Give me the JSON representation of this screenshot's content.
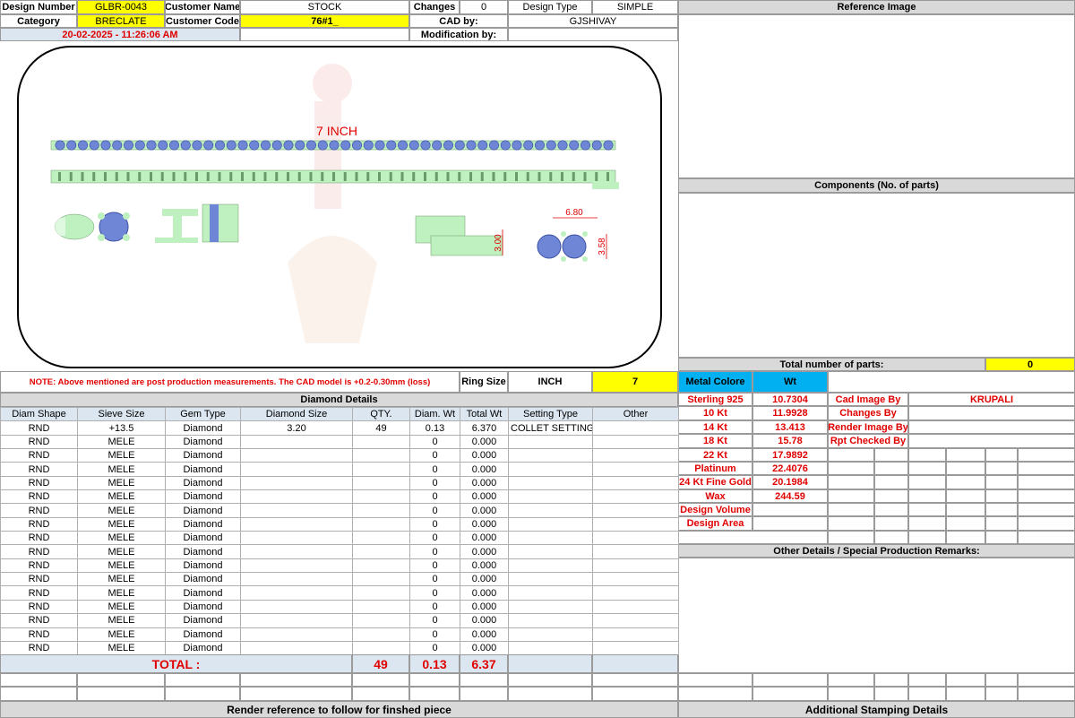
{
  "header": {
    "design_number_label": "Design Number",
    "design_number": "GLBR-0043",
    "customer_name_label": "Customer Name",
    "customer_name": "STOCK",
    "changes_label": "Changes",
    "changes": "0",
    "design_type_label": "Design Type",
    "design_type": "SIMPLE",
    "category_label": "Category",
    "category": "BRECLATE",
    "customer_code_label": "Customer Code",
    "customer_code": "76#1_",
    "cad_by_label": "CAD by:",
    "cad_by": "GJSHIVAY",
    "datetime": "20-02-2025 - 11:26:06 AM",
    "modification_by_label": "Modification by:"
  },
  "drawing": {
    "length_label": "7 INCH",
    "dim_width": "6.80",
    "dim_height1": "3.00",
    "dim_height2": "3.58"
  },
  "right_panel": {
    "reference_image_label": "Reference Image",
    "components_label": "Components (No. of parts)",
    "total_parts_label": "Total number of parts:",
    "total_parts": "0",
    "metal_colore_label": "Metal Colore",
    "wt_label": "Wt",
    "metals": [
      {
        "name": "Sterling 925",
        "wt": "10.7304"
      },
      {
        "name": "10 Kt",
        "wt": "11.9928"
      },
      {
        "name": "14 Kt",
        "wt": "13.413"
      },
      {
        "name": "18 Kt",
        "wt": "15.78"
      },
      {
        "name": "22 Kt",
        "wt": "17.9892"
      },
      {
        "name": "Platinum",
        "wt": "22.4076"
      },
      {
        "name": "24 Kt Fine Gold",
        "wt": "20.1984"
      },
      {
        "name": "Wax",
        "wt": "244.59"
      },
      {
        "name": "Design Volume",
        "wt": ""
      },
      {
        "name": "Design Area",
        "wt": ""
      }
    ],
    "cad_image_by_label": "Cad Image By",
    "cad_image_by": "KRUPALI",
    "changes_by_label": "Changes By",
    "render_image_by_label": "Render Image By",
    "rpt_checked_by_label": "Rpt Checked By",
    "other_details_label": "Other Details / Special Production Remarks:",
    "stamping_label": "Additional Stamping Details"
  },
  "note": {
    "text": "NOTE: Above mentioned are post production measurements. The CAD model is +0.2-0.30mm (loss)",
    "ring_size_label": "Ring Size",
    "ring_size_unit": "INCH",
    "ring_size_value": "7"
  },
  "diamond": {
    "title": "Diamond Details",
    "headers": [
      "Diam Shape",
      "Sieve Size",
      "Gem Type",
      "Diamond Size",
      "QTY.",
      "Diam. Wt",
      "Total Wt",
      "Setting Type",
      "Other"
    ],
    "rows": [
      [
        "RND",
        "+13.5",
        "Diamond",
        "3.20",
        "49",
        "0.13",
        "6.370",
        "COLLET SETTING",
        ""
      ],
      [
        "RND",
        "MELE",
        "Diamond",
        "",
        "",
        "0",
        "0.000",
        "",
        ""
      ],
      [
        "RND",
        "MELE",
        "Diamond",
        "",
        "",
        "0",
        "0.000",
        "",
        ""
      ],
      [
        "RND",
        "MELE",
        "Diamond",
        "",
        "",
        "0",
        "0.000",
        "",
        ""
      ],
      [
        "RND",
        "MELE",
        "Diamond",
        "",
        "",
        "0",
        "0.000",
        "",
        ""
      ],
      [
        "RND",
        "MELE",
        "Diamond",
        "",
        "",
        "0",
        "0.000",
        "",
        ""
      ],
      [
        "RND",
        "MELE",
        "Diamond",
        "",
        "",
        "0",
        "0.000",
        "",
        ""
      ],
      [
        "RND",
        "MELE",
        "Diamond",
        "",
        "",
        "0",
        "0.000",
        "",
        ""
      ],
      [
        "RND",
        "MELE",
        "Diamond",
        "",
        "",
        "0",
        "0.000",
        "",
        ""
      ],
      [
        "RND",
        "MELE",
        "Diamond",
        "",
        "",
        "0",
        "0.000",
        "",
        ""
      ],
      [
        "RND",
        "MELE",
        "Diamond",
        "",
        "",
        "0",
        "0.000",
        "",
        ""
      ],
      [
        "RND",
        "MELE",
        "Diamond",
        "",
        "",
        "0",
        "0.000",
        "",
        ""
      ],
      [
        "RND",
        "MELE",
        "Diamond",
        "",
        "",
        "0",
        "0.000",
        "",
        ""
      ],
      [
        "RND",
        "MELE",
        "Diamond",
        "",
        "",
        "0",
        "0.000",
        "",
        ""
      ],
      [
        "RND",
        "MELE",
        "Diamond",
        "",
        "",
        "0",
        "0.000",
        "",
        ""
      ],
      [
        "RND",
        "MELE",
        "Diamond",
        "",
        "",
        "0",
        "0.000",
        "",
        ""
      ],
      [
        "RND",
        "MELE",
        "Diamond",
        "",
        "",
        "0",
        "0.000",
        "",
        ""
      ]
    ],
    "total_label": "TOTAL :",
    "total_qty": "49",
    "total_diam_wt": "0.13",
    "total_wt": "6.37"
  },
  "footer": {
    "render_reference": "Render reference to follow for finshed piece"
  },
  "colors": {
    "yellow": "#ffff00",
    "blue_header": "#dce6f1",
    "metal_header": "#00b0f0",
    "gem": "#6f86d6",
    "metal": "#bff0c0",
    "red_text": "#e00000"
  }
}
